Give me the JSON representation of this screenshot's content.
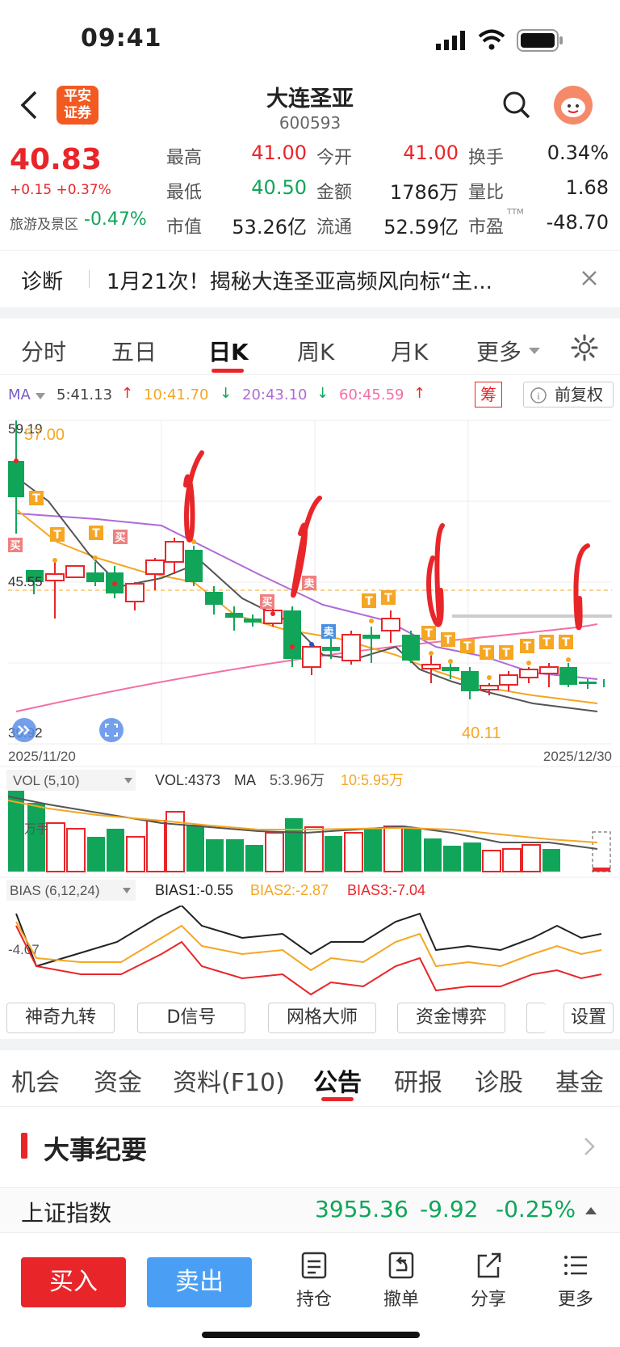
{
  "status_bar": {
    "time": "09:41"
  },
  "header": {
    "logo_line1": "平安",
    "logo_line2": "证券",
    "stock_name": "大连圣亚",
    "stock_code": "600593"
  },
  "quote": {
    "price": "40.83",
    "change": "+0.15 +0.37%",
    "sector_label": "旅游及景区",
    "sector_change": "-0.47%",
    "rows": [
      [
        {
          "label": "最高",
          "value": "41.00"
        },
        {
          "label": "今开",
          "value": "41.00"
        },
        {
          "label": "换手",
          "value": "0.34%"
        }
      ],
      [
        {
          "label": "最低",
          "value": "40.50"
        },
        {
          "label": "金额",
          "value": "1786万"
        },
        {
          "label": "量比",
          "value": "1.68"
        }
      ],
      [
        {
          "label": "市值",
          "value": "53.26亿"
        },
        {
          "label": "流通",
          "value": "52.59亿"
        },
        {
          "label": "市盈",
          "value": "-48.70",
          "sup": "TTM"
        }
      ]
    ]
  },
  "diagnosis": {
    "label": "诊断",
    "text": "1月21次！揭秘大连圣亚高频风向标“主..."
  },
  "period_tabs": [
    "分时",
    "五日",
    "日K",
    "周K",
    "月K",
    "更多"
  ],
  "ma_bar": {
    "label": "MA",
    "ma5": "5:41.13",
    "ma10": "10:41.70",
    "ma20": "20:43.10",
    "ma60": "60:45.59",
    "chip": "筹",
    "adjust": "前复权"
  },
  "kline": {
    "high_label": "59.19",
    "high_marker": "57.00",
    "mid_label": "45.55",
    "low_label": "39.92",
    "low_marker": "40.11",
    "start_date": "2025/11/20",
    "end_date": "2025/12/30",
    "marker_T": "T",
    "marker_buy": "买",
    "marker_sell": "卖"
  },
  "vol_bar": {
    "label": "VOL (5,10)",
    "vol": "VOL:4373",
    "ma": "MA",
    "ma5": "5:3.96万",
    "ma10": "10:5.95万",
    "axis": "万手"
  },
  "bias_bar": {
    "label": "BIAS (6,12,24)",
    "b1": "BIAS1:-0.55",
    "b2": "BIAS2:-2.87",
    "b3": "BIAS3:-7.04",
    "axis": "-4.07"
  },
  "indicator_buttons": [
    "神奇九转",
    "D信号",
    "网格大师",
    "资金博弈",
    "",
    "设置"
  ],
  "bottom_tabs": [
    "机会",
    "资金",
    "资料(F10)",
    "公告",
    "研报",
    "诊股",
    "基金"
  ],
  "event": {
    "title": "大事纪要"
  },
  "index": {
    "name": "上证指数",
    "value": "3955.36",
    "change": "-9.92",
    "pct": "-0.25%"
  },
  "actions": {
    "buy": "买入",
    "sell": "卖出",
    "tools": [
      "持仓",
      "撤单",
      "分享",
      "更多"
    ]
  },
  "colors": {
    "up": "#e8262a",
    "down": "#11a55a",
    "ma5": "#555555",
    "ma10": "#f5a623",
    "ma20": "#b06ad8",
    "ma60": "#f36fa6",
    "accent": "#e8262a"
  }
}
